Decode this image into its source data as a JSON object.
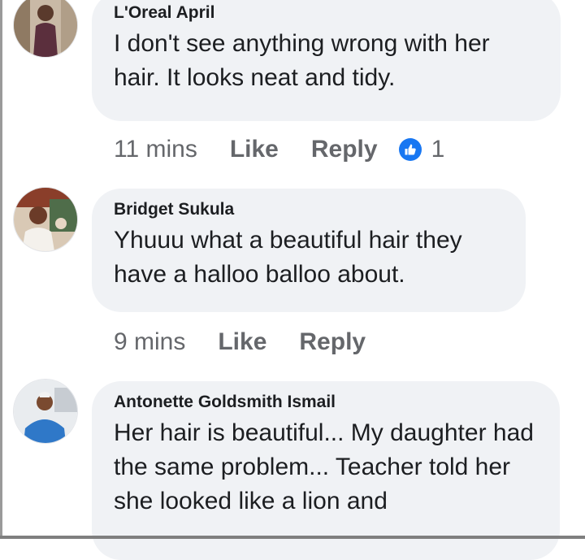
{
  "comments": [
    {
      "author": "L'Oreal April",
      "text": "I don't see anything wrong with her hair. It looks neat and tidy.",
      "time": "11 mins",
      "like_label": "Like",
      "reply_label": "Reply",
      "reaction_count": "1",
      "reaction_icon": "thumbs-up-icon"
    },
    {
      "author": "Bridget Sukula",
      "text": "Yhuuu what a beautiful hair they have a halloo balloo about.",
      "time": "9 mins",
      "like_label": "Like",
      "reply_label": "Reply"
    },
    {
      "author": "Antonette Goldsmith Ismail",
      "text": "Her hair is beautiful... My daughter had the same problem... Teacher told her she looked like a lion and"
    }
  ],
  "colors": {
    "bubble": "#f0f2f5",
    "text": "#1c1e21",
    "meta": "#65676b",
    "like_blue": "#1877f2"
  }
}
